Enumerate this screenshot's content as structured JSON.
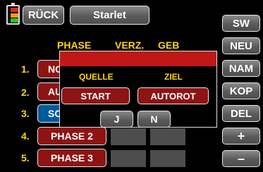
{
  "battery": {
    "colors": [
      "#e02020",
      "#f0a000",
      "#30c030"
    ]
  },
  "top": {
    "back_label": "RÜCK",
    "model_name": "Starlet"
  },
  "headers": {
    "phase": "PHASE",
    "delay": "VERZ.",
    "switch": "GEB"
  },
  "rows": [
    {
      "num": "1.",
      "label": "NO"
    },
    {
      "num": "2.",
      "label": "AU"
    },
    {
      "num": "3.",
      "label": "SC"
    },
    {
      "num": "4.",
      "label": "PHASE 2"
    },
    {
      "num": "5.",
      "label": "PHASE 3"
    }
  ],
  "side": {
    "sw": "SW",
    "neu": "NEU",
    "nam": "NAM",
    "kop": "KOP",
    "del": "DEL",
    "plus": "+",
    "minus": "–"
  },
  "dialog": {
    "source_label": "QUELLE",
    "target_label": "ZIEL",
    "source_value": "START",
    "target_value": "AUTOROT",
    "yes_label": "J",
    "no_label": "N"
  },
  "colors": {
    "accent_yellow": "#ffd21c",
    "dialog_red": "#c01818",
    "button_red": "#8e1414",
    "selected_blue": "#005a9c"
  }
}
